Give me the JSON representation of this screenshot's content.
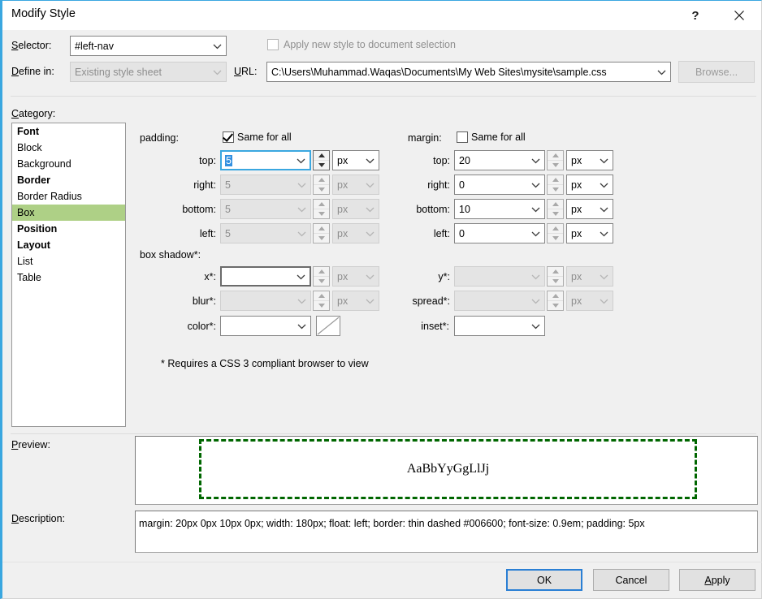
{
  "window": {
    "title": "Modify Style",
    "help_icon": "question-mark-icon",
    "close_icon": "close-icon"
  },
  "top": {
    "selector_label": "Selector:",
    "selector_value": "#left-nav",
    "define_in_label": "Define in:",
    "define_in_value": "Existing style sheet",
    "apply_checkbox_label": "Apply new style to document selection",
    "apply_checkbox_checked": false,
    "url_label": "URL:",
    "url_value": "C:\\Users\\Muhammad.Waqas\\Documents\\My Web Sites\\mysite\\sample.css",
    "browse_label": "Browse..."
  },
  "category": {
    "label": "Category:",
    "items": [
      {
        "label": "Font",
        "bold": true,
        "selected": false
      },
      {
        "label": "Block",
        "bold": false,
        "selected": false
      },
      {
        "label": "Background",
        "bold": false,
        "selected": false
      },
      {
        "label": "Border",
        "bold": true,
        "selected": false
      },
      {
        "label": "Border Radius",
        "bold": false,
        "selected": false
      },
      {
        "label": "Box",
        "bold": false,
        "selected": true
      },
      {
        "label": "Position",
        "bold": true,
        "selected": false
      },
      {
        "label": "Layout",
        "bold": true,
        "selected": false
      },
      {
        "label": "List",
        "bold": false,
        "selected": false
      },
      {
        "label": "Table",
        "bold": false,
        "selected": false
      }
    ],
    "selected_color": "#aed086"
  },
  "padding": {
    "label": "padding:",
    "same_for_all_label": "Same for all",
    "same_for_all_checked": true,
    "rows": [
      {
        "label": "top:",
        "value": "5",
        "unit": "px",
        "enabled": true,
        "focused": true
      },
      {
        "label": "right:",
        "value": "5",
        "unit": "px",
        "enabled": false,
        "focused": false
      },
      {
        "label": "bottom:",
        "value": "5",
        "unit": "px",
        "enabled": false,
        "focused": false
      },
      {
        "label": "left:",
        "value": "5",
        "unit": "px",
        "enabled": false,
        "focused": false
      }
    ]
  },
  "margin": {
    "label": "margin:",
    "same_for_all_label": "Same for all",
    "same_for_all_checked": false,
    "rows": [
      {
        "label": "top:",
        "value": "20",
        "unit": "px",
        "enabled": true,
        "focused": false
      },
      {
        "label": "right:",
        "value": "0",
        "unit": "px",
        "enabled": true,
        "focused": false
      },
      {
        "label": "bottom:",
        "value": "10",
        "unit": "px",
        "enabled": true,
        "focused": false
      },
      {
        "label": "left:",
        "value": "0",
        "unit": "px",
        "enabled": true,
        "focused": false
      }
    ]
  },
  "box_shadow": {
    "label": "box shadow*:",
    "left_rows": [
      {
        "label": "x*:",
        "value": "",
        "unit": "px",
        "enabled": true
      },
      {
        "label": "blur*:",
        "value": "",
        "unit": "px",
        "enabled": false
      }
    ],
    "right_rows": [
      {
        "label": "y*:",
        "value": "",
        "unit": "px",
        "enabled": false
      },
      {
        "label": "spread*:",
        "value": "",
        "unit": "px",
        "enabled": false
      }
    ],
    "color_label": "color*:",
    "color_value": "",
    "color_swatch": "none",
    "inset_label": "inset*:",
    "inset_value": ""
  },
  "footnote": "* Requires a CSS 3 compliant browser to view",
  "preview": {
    "label": "Preview:",
    "sample_text": "AaBbYyGgLlJj",
    "border_color": "#006600"
  },
  "description": {
    "label": "Description:",
    "text": "margin: 20px 0px 10px 0px; width: 180px; float: left; border: thin dashed #006600; font-size: 0.9em; padding: 5px"
  },
  "buttons": {
    "ok": "OK",
    "cancel": "Cancel",
    "apply": "Apply"
  }
}
